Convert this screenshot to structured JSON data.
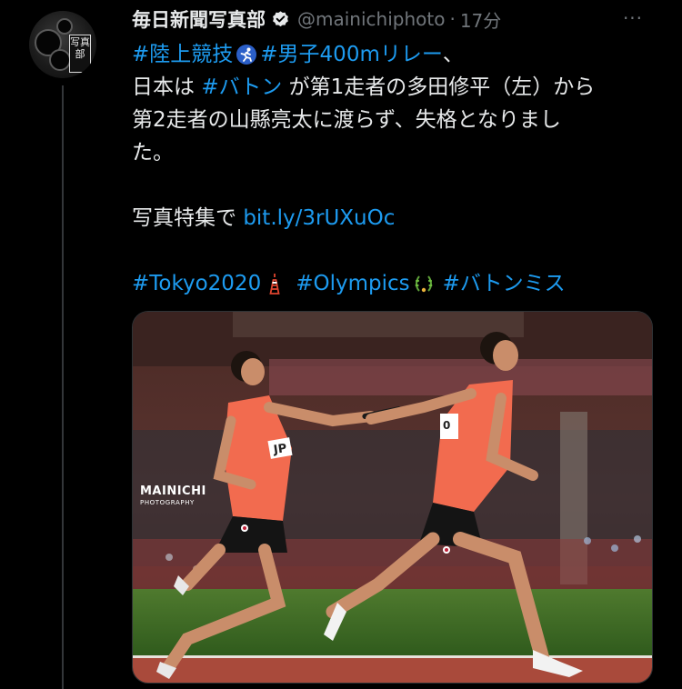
{
  "tweet": {
    "display_name": "毎日新聞写真部",
    "handle": "@mainichiphoto",
    "separator": "·",
    "time": "17分",
    "more_label": "···",
    "avatar_seal_text": "写真部",
    "verified": true,
    "icons": {
      "verified": "verified-badge-icon",
      "more": "more-options-icon",
      "athletics_emoji": "runner-emoji",
      "tower_emoji": "tokyo-tower-emoji",
      "laurel_emoji": "olympic-laurel-emoji"
    },
    "body": {
      "line1": {
        "tag1": "#陸上競技",
        "tag2": "#男子400mリレー",
        "suffix": "、"
      },
      "line2": {
        "prefix": "日本は ",
        "tag": "#バトン",
        "rest": " が第1走者の多田修平（左）から"
      },
      "line3": "第2走者の山縣亮太に渡らず、失格となりまし",
      "line4": "た。",
      "line5": {
        "prefix": "写真特集で ",
        "link": "bit.ly/3rUXuOc"
      },
      "line6": {
        "tag1": "#Tokyo2020",
        "tag2": "#Olympics",
        "tag3": "#バトンミス"
      }
    },
    "media": {
      "watermark": "MAINICHI",
      "watermark_sub": "PHOTOGRAPHY",
      "bib_left": "JP",
      "bib_right": "0"
    },
    "colors": {
      "background": "#000000",
      "text": "#e7e9ea",
      "secondary": "#71767b",
      "link": "#1d9bf0",
      "uniform": "#f26b4f"
    }
  }
}
